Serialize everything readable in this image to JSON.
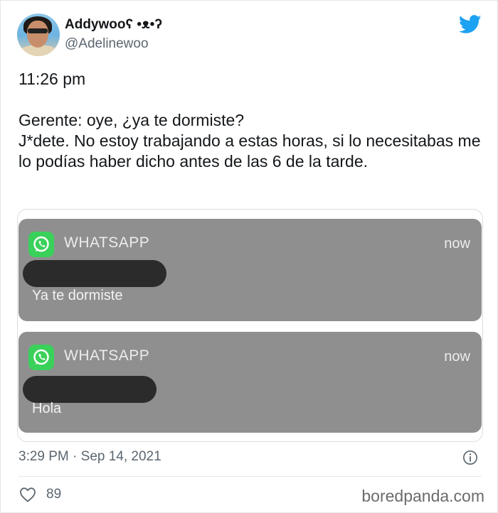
{
  "author": {
    "display_name": "Addywooʕ •ᴥ•ʔ",
    "handle": "@Adelinewoo"
  },
  "tweet": {
    "lines": [
      "11:26 pm",
      "Gerente: oye, ¿ya te dormiste?",
      "J*dete. No estoy trabajando a estas horas, si lo necesitabas me lo podías haber dicho antes de las 6 de la tarde."
    ]
  },
  "notifications": [
    {
      "app": "WHATSAPP",
      "time": "now",
      "message": "Ya te dormiste"
    },
    {
      "app": "WHATSAPP",
      "time": "now",
      "message": "Hola"
    }
  ],
  "footer": {
    "timestamp": "3:29 PM · Sep 14, 2021",
    "likes": "89"
  },
  "watermark": "boredpanda.com",
  "colors": {
    "twitter_blue": "#1da1f2",
    "notification_bg": "#8f8f8f",
    "whatsapp_green": "#3ad15a"
  }
}
